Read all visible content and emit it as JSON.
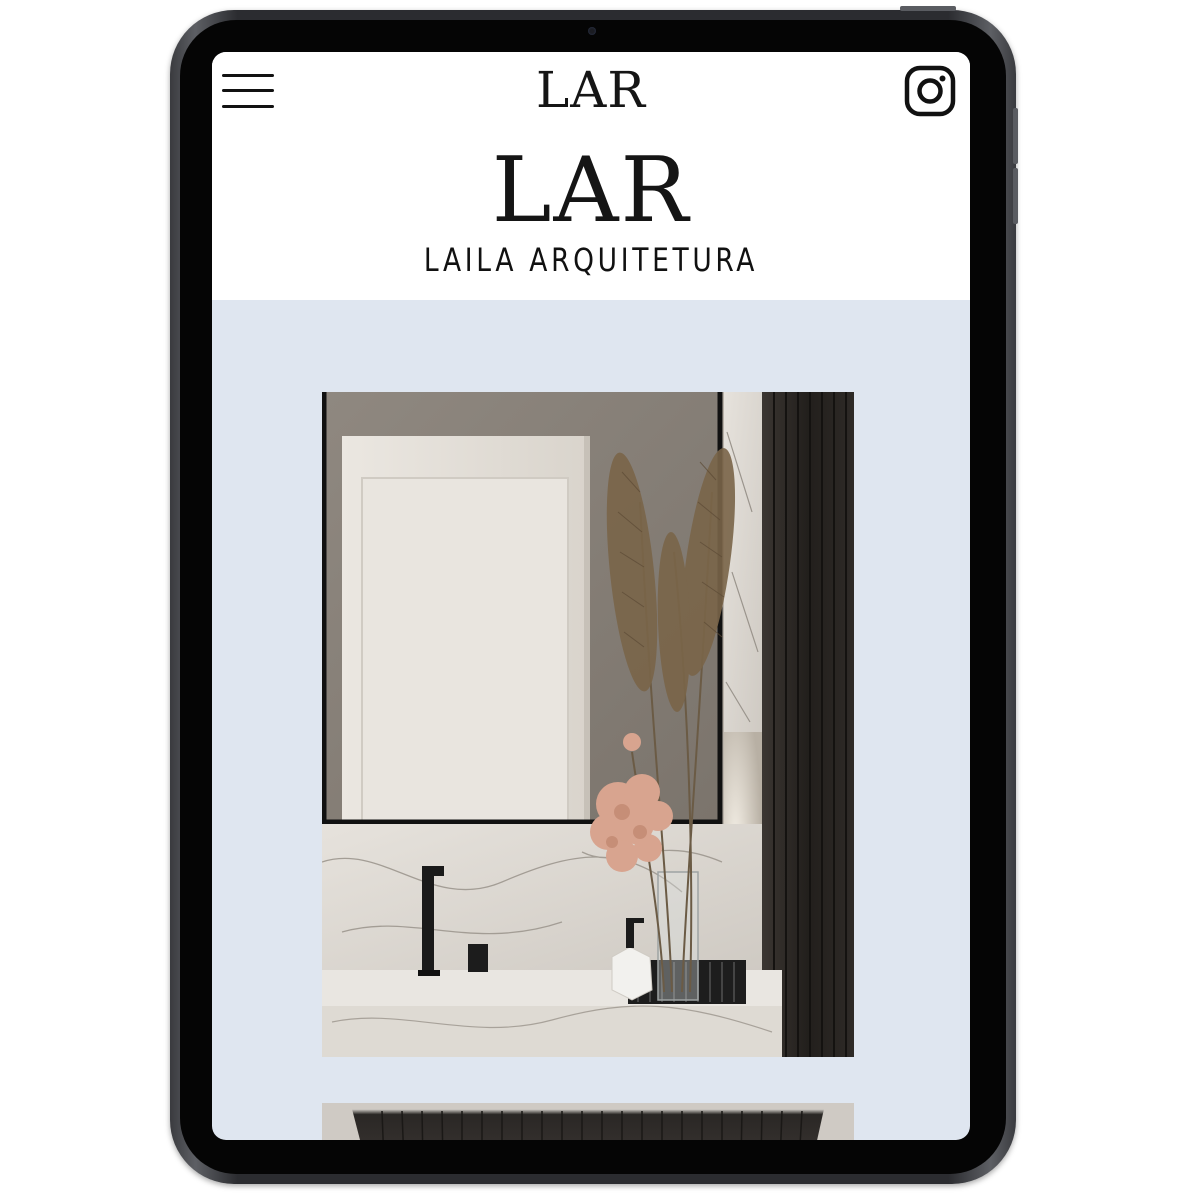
{
  "header": {
    "nav_logo": "LAR",
    "brand_logo": "LAR",
    "brand_tagline": "LAILA ARQUITETURA",
    "menu_icon": "hamburger-menu-icon",
    "social_icon": "instagram-icon"
  },
  "colors": {
    "page_background": "#dfe6f0",
    "header_background": "#ffffff",
    "text": "#111111"
  },
  "gallery": [
    {
      "subject": "bathroom vanity with marble sink, black framed mirror, black faucet and pampas grass vase"
    },
    {
      "subject": "dark fluted panel (partially visible)"
    }
  ]
}
